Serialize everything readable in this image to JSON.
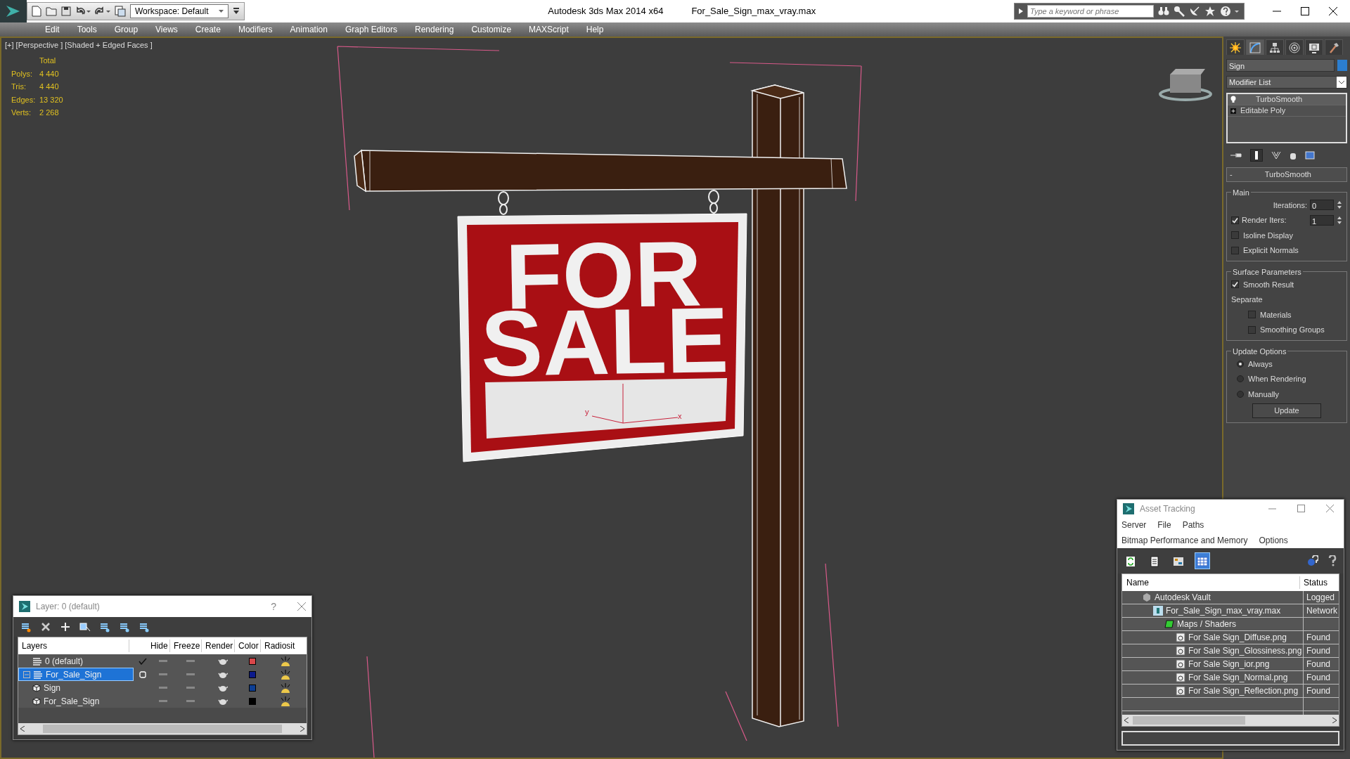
{
  "title_bar": {
    "app_title": "Autodesk 3ds Max  2014 x64",
    "file_name": "For_Sale_Sign_max_vray.max",
    "workspace": "Workspace: Default",
    "search_placeholder": "Type a keyword or phrase"
  },
  "menu": [
    "Edit",
    "Tools",
    "Group",
    "Views",
    "Create",
    "Modifiers",
    "Animation",
    "Graph Editors",
    "Rendering",
    "Customize",
    "MAXScript",
    "Help"
  ],
  "viewport": {
    "label": "[+] [Perspective ] [Shaded + Edged Faces ]",
    "stats_header": "Total",
    "stats": [
      {
        "label": "Polys:",
        "value": "4 440"
      },
      {
        "label": "Tris:",
        "value": "4 440"
      },
      {
        "label": "Edges:",
        "value": "13 320"
      },
      {
        "label": "Verts:",
        "value": "2 268"
      }
    ],
    "sign_lines": [
      "FOR",
      "SALE"
    ],
    "axis_labels": [
      "y",
      "x"
    ]
  },
  "command_panel": {
    "tabs": [
      {
        "selected": false
      },
      {
        "selected": true
      },
      {
        "selected": false
      },
      {
        "selected": false
      },
      {
        "selected": false
      },
      {
        "selected": false
      }
    ],
    "object": {
      "name": "Sign",
      "color": "#2b7ed0"
    },
    "modifier_list": "Modifier List",
    "stack": [
      {
        "label": "TurboSmooth",
        "kind": "modifier",
        "selected": true
      },
      {
        "label": "Editable Poly",
        "kind": "base",
        "selected": false
      }
    ],
    "rollout": {
      "toggle": "-",
      "title": "TurboSmooth",
      "groups": [
        {
          "title": "Main",
          "items": [
            {
              "kind": "spinner",
              "label": "Iterations:",
              "value": "0"
            },
            {
              "kind": "checked-spinner",
              "label": "Render Iters:",
              "value": "1",
              "checked": true
            },
            {
              "kind": "checkbox",
              "label": "Isoline Display",
              "checked": false
            },
            {
              "kind": "checkbox",
              "label": "Explicit Normals",
              "checked": false
            }
          ]
        },
        {
          "title": "Surface Parameters",
          "items": [
            {
              "kind": "checkbox",
              "label": "Smooth Result",
              "checked": true
            },
            {
              "kind": "label",
              "label": "Separate",
              "children": [
                {
                  "kind": "checkbox",
                  "label": "Materials",
                  "checked": false
                },
                {
                  "kind": "checkbox",
                  "label": "Smoothing Groups",
                  "checked": false
                }
              ]
            }
          ]
        },
        {
          "title": "Update Options",
          "items": [
            {
              "kind": "radio",
              "label": "Always",
              "selected": true
            },
            {
              "kind": "radio",
              "label": "When Rendering",
              "selected": false
            },
            {
              "kind": "radio",
              "label": "Manually",
              "selected": false
            },
            {
              "kind": "button",
              "label": "Update"
            }
          ]
        }
      ]
    }
  },
  "layer_dialog": {
    "title": "Layer: 0 (default)",
    "help": "?",
    "columns": [
      "Layers",
      "Hide",
      "Freeze",
      "Render",
      "Color",
      "Radiosit"
    ],
    "rows": [
      {
        "name": "0 (default)",
        "kind": "layer",
        "current": true,
        "selected": false,
        "expanded": false,
        "color": "#d9474a"
      },
      {
        "name": "For_Sale_Sign",
        "kind": "layer",
        "current": false,
        "selected": true,
        "expanded": true,
        "color": "#0b1a8c",
        "children": [
          {
            "name": "Sign",
            "kind": "object",
            "selected": false,
            "color": "#0c3e94"
          },
          {
            "name": "For_Sale_Sign",
            "kind": "object",
            "selected": false,
            "color": "#000000"
          }
        ]
      }
    ]
  },
  "asset_tracking": {
    "title": "Asset Tracking",
    "menu_rows": [
      [
        "Server",
        "File",
        "Paths"
      ],
      [
        "Bitmap Performance and Memory",
        "Options"
      ]
    ],
    "toolbar": [
      {
        "selected": false
      },
      {
        "selected": false
      },
      {
        "selected": false
      },
      {
        "selected": true
      }
    ],
    "columns": [
      "Name",
      "Status"
    ],
    "rows": [
      {
        "name": "Autodesk Vault",
        "kind": "vault",
        "status": "Logged",
        "children": [
          {
            "name": "For_Sale_Sign_max_vray.max",
            "kind": "scene",
            "status": "Network",
            "children": [
              {
                "name": "Maps / Shaders",
                "kind": "maps",
                "children": [
                  {
                    "name": "For Sale Sign_Diffuse.png",
                    "kind": "bitmap",
                    "status": "Found"
                  },
                  {
                    "name": "For Sale Sign_Glossiness.png",
                    "kind": "bitmap",
                    "status": "Found"
                  },
                  {
                    "name": "For Sale Sign_ior.png",
                    "kind": "bitmap",
                    "status": "Found"
                  },
                  {
                    "name": "For Sale Sign_Normal.png",
                    "kind": "bitmap",
                    "status": "Found"
                  },
                  {
                    "name": "For Sale Sign_Reflection.png",
                    "kind": "bitmap",
                    "status": "Found"
                  }
                ]
              }
            ]
          }
        ]
      }
    ]
  }
}
